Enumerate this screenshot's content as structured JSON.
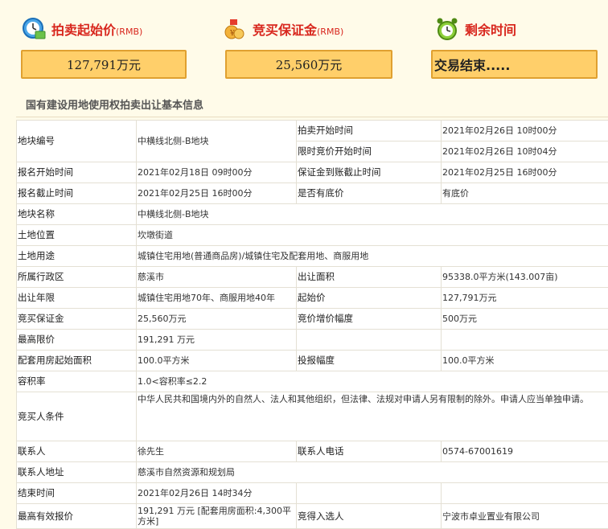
{
  "stats": {
    "start_price": {
      "title": "拍卖起始价",
      "unit": "(RMB)",
      "value": "127,791万元",
      "icon": "clock-money-icon"
    },
    "deposit": {
      "title": "竞买保证金",
      "unit": "(RMB)",
      "value": "25,560万元",
      "icon": "money-bag-icon"
    },
    "remaining": {
      "title": "剩余时间",
      "value": "交易结束.....",
      "icon": "alarm-clock-icon"
    }
  },
  "section_title": "国有建设用地使用权拍卖出让基本信息",
  "info": {
    "parcel_no_label": "地块编号",
    "parcel_no": "中横线北侧-B地块",
    "auction_start_label": "拍卖开始时间",
    "auction_start": "2021年02月26日 10时00分",
    "timed_bid_start_label": "限时竞价开始时间",
    "timed_bid_start": "2021年02月26日 10时04分",
    "reg_start_label": "报名开始时间",
    "reg_start": "2021年02月18日 09时00分",
    "deposit_deadline_label": "保证金到账截止时间",
    "deposit_deadline": "2021年02月25日 16时00分",
    "reg_end_label": "报名截止时间",
    "reg_end": "2021年02月25日 16时00分",
    "reserve_label": "是否有底价",
    "reserve": "有底价",
    "parcel_name_label": "地块名称",
    "parcel_name": "中横线北侧-B地块",
    "location_label": "土地位置",
    "location": "坎墩街道",
    "usage_label": "土地用途",
    "usage": "城镇住宅用地(普通商品房)/城镇住宅及配套用地、商服用地",
    "district_label": "所属行政区",
    "district": "慈溪市",
    "area_label": "出让面积",
    "area": "95338.0平方米(143.007亩)",
    "term_label": "出让年限",
    "term": "城镇住宅用地70年、商服用地40年",
    "start_price_label": "起始价",
    "start_price": "127,791万元",
    "bid_deposit_label": "竞买保证金",
    "bid_deposit": "25,560万元",
    "increment_label": "竞价增价幅度",
    "increment": "500万元",
    "max_price_label": "最高限价",
    "max_price": "191,291 万元",
    "housing_start_label": "配套用房起始面积",
    "housing_start": "100.0平方米",
    "bid_step_label": "投报幅度",
    "bid_step": "100.0平方米",
    "far_label": "容积率",
    "far": "1.0<容积率≤2.2",
    "conditions_label": "竞买人条件",
    "conditions": "中华人民共和国境内外的自然人、法人和其他组织，但法律、法规对申请人另有限制的除外。申请人应当单独申请。",
    "contact_label": "联系人",
    "contact": "徐先生",
    "phone_label": "联系人电话",
    "phone": "0574-67001619",
    "address_label": "联系人地址",
    "address": "慈溪市自然资源和规划局",
    "end_time_label": "结束时间",
    "end_time": "2021年02月26日 14时34分",
    "top_bid_label": "最高有效报价",
    "top_bid": "191,291 万元 [配套用房面积:4,300平方米]",
    "winner_label": "竞得入选人",
    "winner": "宁波市卓业置业有限公司"
  }
}
